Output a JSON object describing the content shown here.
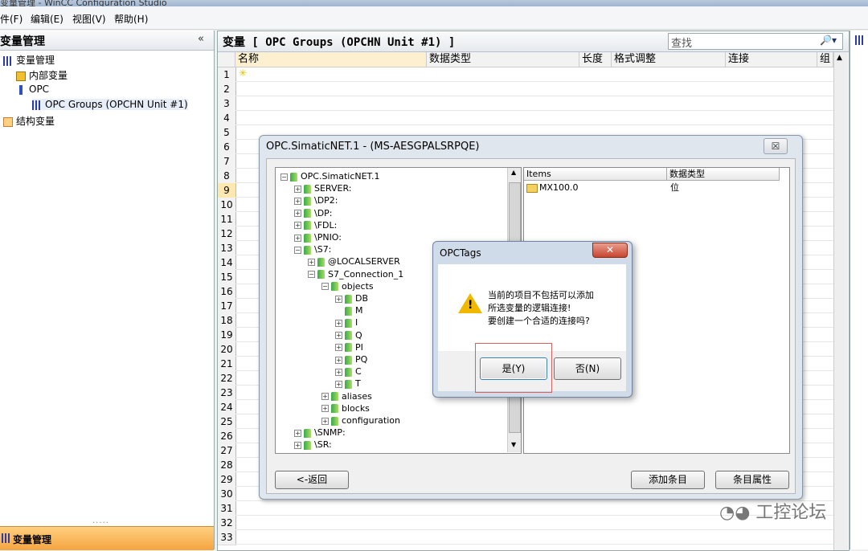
{
  "window": {
    "title": "变量管理 - WinCC Configuration Studio"
  },
  "menu": [
    "件(F)",
    "编辑(E)",
    "视图(V)",
    "帮助(H)"
  ],
  "left_panel": {
    "title": "变量管理",
    "collapse": "«",
    "tree": [
      "变量管理",
      "内部变量",
      "OPC",
      "OPC Groups (OPCHN Unit #1)",
      "结构变量"
    ],
    "bottom_label": "变量管理",
    "grip": "....."
  },
  "main": {
    "title": "变量 [ OPC Groups (OPCHN Unit #1) ]",
    "search_placeholder": "查找",
    "columns": [
      "名称",
      "数据类型",
      "长度",
      "格式调整",
      "连接",
      "组"
    ],
    "rows": [
      "1",
      "2",
      "3",
      "4",
      "5",
      "6",
      "7",
      "8",
      "9",
      "10",
      "11",
      "12",
      "13",
      "14",
      "15",
      "16",
      "17",
      "18",
      "19",
      "20",
      "21",
      "22",
      "23",
      "24",
      "25",
      "26",
      "27",
      "28",
      "29",
      "30",
      "31",
      "32",
      "33"
    ]
  },
  "opc_dialog": {
    "title": "OPC.SimaticNET.1 - (MS-AESGPALSRPQE)",
    "close": "☒",
    "tree": [
      {
        "label": "OPC.SimaticNET.1",
        "lvl": 0,
        "pm": "−"
      },
      {
        "label": "SERVER:",
        "lvl": 1,
        "pm": "+"
      },
      {
        "label": "\\DP2:",
        "lvl": 1,
        "pm": "+"
      },
      {
        "label": "\\DP:",
        "lvl": 1,
        "pm": "+"
      },
      {
        "label": "\\FDL:",
        "lvl": 1,
        "pm": "+"
      },
      {
        "label": "\\PNIO:",
        "lvl": 1,
        "pm": "+"
      },
      {
        "label": "\\S7:",
        "lvl": 1,
        "pm": "−"
      },
      {
        "label": "@LOCALSERVER",
        "lvl": 2,
        "pm": "+"
      },
      {
        "label": "S7_Connection_1",
        "lvl": 2,
        "pm": "−"
      },
      {
        "label": "objects",
        "lvl": 3,
        "pm": "−"
      },
      {
        "label": "DB",
        "lvl": 4,
        "pm": "+"
      },
      {
        "label": "M",
        "lvl": 4,
        "pm": ""
      },
      {
        "label": "I",
        "lvl": 4,
        "pm": "+"
      },
      {
        "label": "Q",
        "lvl": 4,
        "pm": "+"
      },
      {
        "label": "PI",
        "lvl": 4,
        "pm": "+"
      },
      {
        "label": "PQ",
        "lvl": 4,
        "pm": "+"
      },
      {
        "label": "C",
        "lvl": 4,
        "pm": "+"
      },
      {
        "label": "T",
        "lvl": 4,
        "pm": "+"
      },
      {
        "label": "aliases",
        "lvl": 3,
        "pm": "+"
      },
      {
        "label": "blocks",
        "lvl": 3,
        "pm": "+"
      },
      {
        "label": "configuration",
        "lvl": 3,
        "pm": "+"
      },
      {
        "label": "\\SNMP:",
        "lvl": 1,
        "pm": "+"
      },
      {
        "label": "\\SR:",
        "lvl": 1,
        "pm": "+"
      }
    ],
    "items_header": [
      "Items",
      "数据类型"
    ],
    "items": [
      {
        "name": "MX100.0",
        "type": "位"
      }
    ],
    "back_button": "<-返回",
    "add_button": "添加条目",
    "props_button": "条目属性"
  },
  "tags_dialog": {
    "title": "OPCTags",
    "close": "✕",
    "message": [
      "当前的项目不包括可以添加",
      "所选变量的逻辑连接!",
      "要创建一个合适的连接吗?"
    ],
    "yes_button": "是(Y)",
    "no_button": "否(N)"
  },
  "watermark": "工控论坛"
}
